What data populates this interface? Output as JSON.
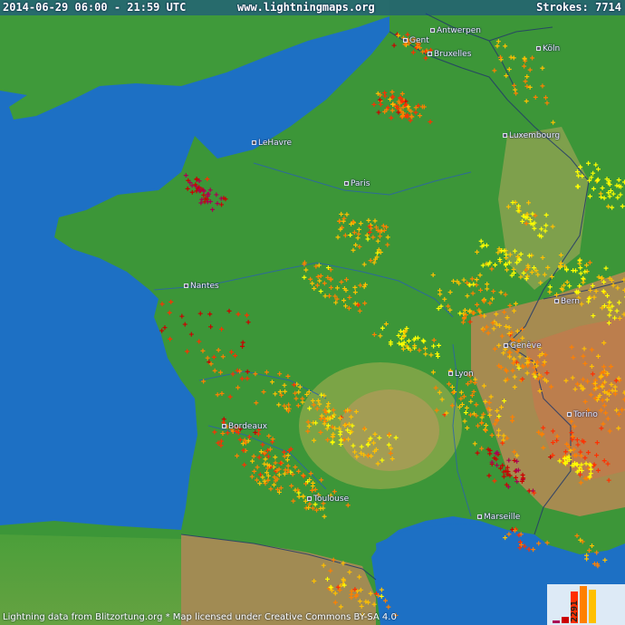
{
  "header": {
    "datetime": "2014-06-29 06:00 - 21:59 UTC",
    "site": "www.lightningmaps.org",
    "strokes_label": "Strokes: 7714"
  },
  "footer": {
    "attribution": "Lightning data from Blitzortung.org  *  Map licensed under Creative Commons BY-SA 4.0"
  },
  "legend": {
    "count_label": "2291",
    "colors": [
      "#ffff00",
      "#ffc000",
      "#ff8000",
      "#ff3000",
      "#cc0000",
      "#aa0055"
    ]
  },
  "cities": [
    {
      "name": "Gent",
      "key": "gent"
    },
    {
      "name": "Antwerpen",
      "key": "antwerpen"
    },
    {
      "name": "Bruxelles",
      "key": "bruxelles"
    },
    {
      "name": "Köln",
      "key": "koln"
    },
    {
      "name": "LeHavre",
      "key": "lehavre"
    },
    {
      "name": "Paris",
      "key": "paris"
    },
    {
      "name": "Luxembourg",
      "key": "luxembourg"
    },
    {
      "name": "Nantes",
      "key": "nantes"
    },
    {
      "name": "Bern",
      "key": "bern"
    },
    {
      "name": "Genève",
      "key": "geneve"
    },
    {
      "name": "Lyon",
      "key": "lyon"
    },
    {
      "name": "Torino",
      "key": "torino"
    },
    {
      "name": "Bordeaux",
      "key": "bordeaux"
    },
    {
      "name": "Toulouse",
      "key": "toulouse"
    },
    {
      "name": "Marseille",
      "key": "marseille"
    }
  ],
  "colors": {
    "sea": "#1b6fc3",
    "land": "#3a9a3a",
    "highland": "#b8a060",
    "mountain": "#c87a4a",
    "border": "#2a3a6a",
    "river": "#2a5fb0"
  }
}
